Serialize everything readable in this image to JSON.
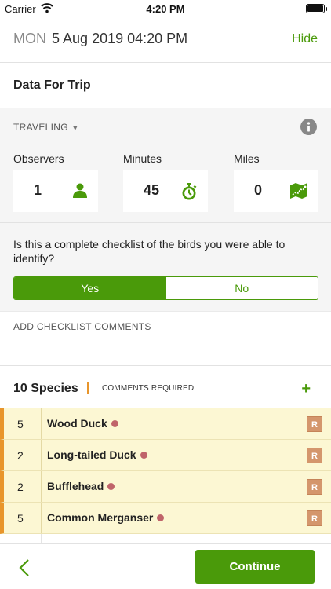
{
  "status": {
    "carrier": "Carrier",
    "time": "4:20 PM"
  },
  "header": {
    "day": "MON",
    "datetime": "5 Aug 2019 04:20 PM",
    "hide_label": "Hide"
  },
  "trip": {
    "title": "Data For Trip",
    "protocol": "TRAVELING"
  },
  "stats": [
    {
      "label": "Observers",
      "value": "1",
      "icon": "person-icon"
    },
    {
      "label": "Minutes",
      "value": "45",
      "icon": "stopwatch-icon"
    },
    {
      "label": "Miles",
      "value": "0",
      "icon": "map-icon"
    }
  ],
  "complete": {
    "question": "Is this a complete checklist of the birds you were able to identify?",
    "yes_label": "Yes",
    "no_label": "No",
    "selected": "Yes"
  },
  "comments": {
    "label": "ADD CHECKLIST COMMENTS"
  },
  "species": {
    "count_label": "10 Species",
    "comments_required": "COMMENTS REQUIRED",
    "rows": [
      {
        "qty": "5",
        "name": "Wood Duck",
        "badge": "R"
      },
      {
        "qty": "2",
        "name": "Long-tailed Duck",
        "badge": "R"
      },
      {
        "qty": "2",
        "name": "Bufflehead",
        "badge": "R"
      },
      {
        "qty": "5",
        "name": "Common Merganser",
        "badge": "R"
      }
    ]
  },
  "footer": {
    "continue_label": "Continue"
  },
  "colors": {
    "accent": "#4a9a0a",
    "warning": "#e8952b",
    "row_bg": "#fcf7d3",
    "badge": "#d4966c",
    "dot": "#c0646a"
  }
}
